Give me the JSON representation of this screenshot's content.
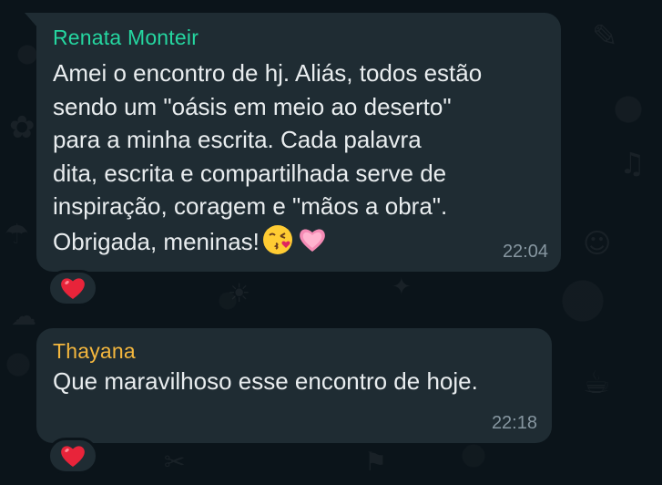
{
  "messages": [
    {
      "sender": "Renata Monteir",
      "lines": [
        "Amei o encontro de hj. Aliás, todos estão",
        "sendo um \"oásis em meio ao deserto\"",
        "para a minha escrita. Cada palavra",
        "dita, escrita e compartilhada serve de",
        "inspiração, coragem e \"mãos a obra\".",
        "Obrigada, meninas!"
      ],
      "emojis": [
        "kissing-face-icon",
        "pink-heart-icon"
      ],
      "time": "22:04",
      "reaction": "red-heart-icon"
    },
    {
      "sender": "Thayana",
      "lines": [
        "Que maravilhoso esse encontro de hoje."
      ],
      "time": "22:18",
      "reaction": "red-heart-icon"
    }
  ],
  "colors": {
    "background": "#0b141a",
    "bubble": "#1f2c33",
    "sender_1": "#25d6a0",
    "sender_2": "#f4b73e",
    "text": "#e9edef",
    "timestamp": "#8696a0"
  }
}
